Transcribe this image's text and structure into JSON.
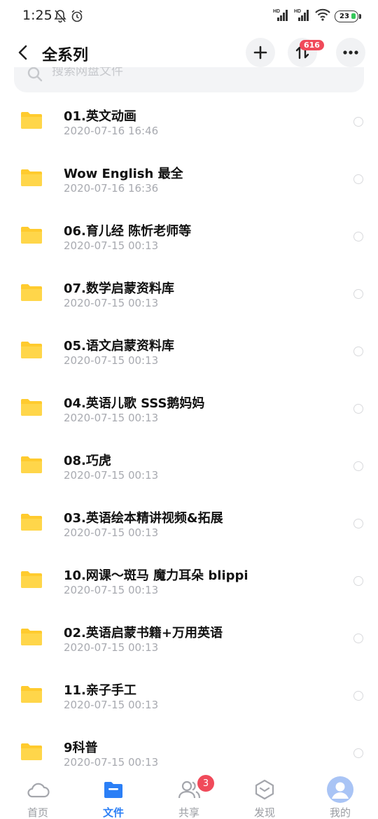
{
  "status": {
    "time": "1:25",
    "battery": "23",
    "signal1": "HD",
    "signal2": "HD"
  },
  "header": {
    "title": "全系列",
    "transfer_badge": "616"
  },
  "search": {
    "placeholder": "搜索网盘文件"
  },
  "files": [
    {
      "name": "01.英文动画",
      "date": "2020-07-16  16:46"
    },
    {
      "name": "Wow English 最全",
      "date": "2020-07-16  16:36"
    },
    {
      "name": "06.育儿经 陈忻老师等",
      "date": "2020-07-15  00:13"
    },
    {
      "name": "07.数学启蒙资料库",
      "date": "2020-07-15  00:13"
    },
    {
      "name": "05.语文启蒙资料库",
      "date": "2020-07-15  00:13"
    },
    {
      "name": "04.英语儿歌 SSS鹅妈妈",
      "date": "2020-07-15  00:13"
    },
    {
      "name": "08.巧虎",
      "date": "2020-07-15  00:13"
    },
    {
      "name": "03.英语绘本精讲视频&拓展",
      "date": "2020-07-15  00:13"
    },
    {
      "name": "10.网课～斑马 魔力耳朵 blippi",
      "date": "2020-07-15  00:13"
    },
    {
      "name": "02.英语启蒙书籍+万用英语",
      "date": "2020-07-15  00:13"
    },
    {
      "name": "11.亲子手工",
      "date": "2020-07-15  00:13"
    },
    {
      "name": "9科普",
      "date": "2020-07-15  00:13"
    }
  ],
  "nav": {
    "items": [
      {
        "label": "首页",
        "icon": "cloud-icon"
      },
      {
        "label": "文件",
        "icon": "folder-icon"
      },
      {
        "label": "共享",
        "icon": "people-icon"
      },
      {
        "label": "发现",
        "icon": "discover-icon"
      },
      {
        "label": "我的",
        "icon": "avatar-icon"
      }
    ],
    "active": "文件",
    "share_badge": "3"
  },
  "colors": {
    "accent": "#2b7ff6",
    "folder": "#ffcb2e",
    "badge": "#f04a5a"
  }
}
